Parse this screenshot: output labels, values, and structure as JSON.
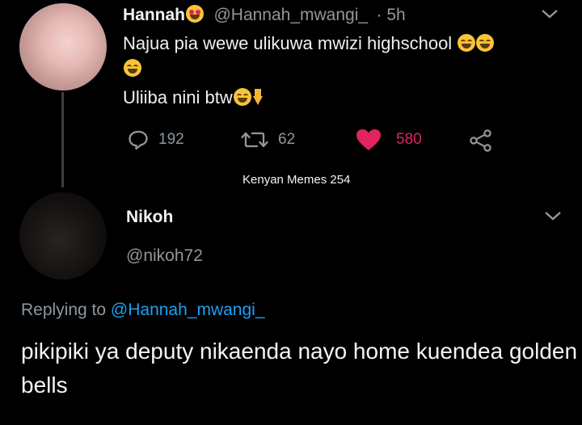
{
  "tweet": {
    "author_name": "Hannah",
    "author_handle": "@Hannah_mwangi_",
    "time": "· 5h",
    "text_line1": "Najua pia wewe ulikuwa mwizi highschool",
    "text_line2": "Uliiba nini btw",
    "actions": {
      "replies": "192",
      "retweets": "62",
      "likes": "580"
    }
  },
  "watermark": "Kenyan Memes 254",
  "reply": {
    "author_name": "Nikoh",
    "author_handle": "@nikoh72",
    "replying_prefix": "Replying to",
    "replying_to": "@Hannah_mwangi_",
    "text": "pikipiki ya deputy nikaenda nayo home kuendea golden bells"
  },
  "colors": {
    "background": "#000000",
    "secondary_text": "#8e979f",
    "like": "#e0245e",
    "link": "#1da1f2"
  },
  "icons": [
    "heart-eyes-emoji",
    "laughing-emoji",
    "pointing-down-emoji",
    "reply-icon",
    "retweet-icon",
    "like-heart-icon",
    "share-icon",
    "chevron-down-icon"
  ]
}
